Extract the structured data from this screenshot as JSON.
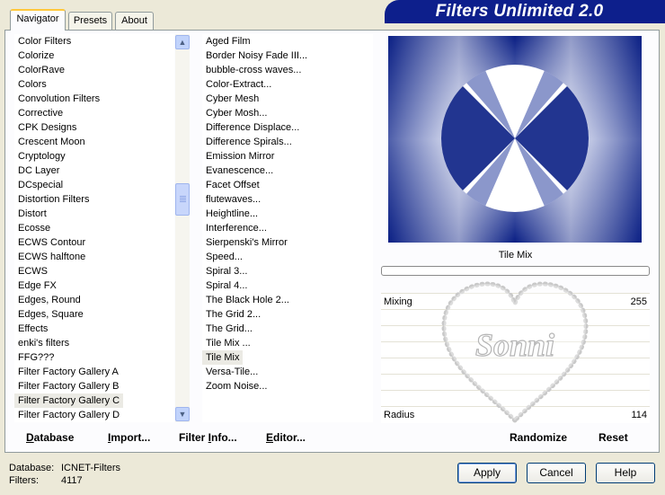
{
  "banner": {
    "title": "Filters Unlimited 2.0"
  },
  "tabs": {
    "navigator": "Navigator",
    "presets": "Presets",
    "about": "About"
  },
  "categories": {
    "items": [
      "Color Filters",
      "Colorize",
      "ColorRave",
      "Colors",
      "Convolution Filters",
      "Corrective",
      "CPK Designs",
      "Crescent Moon",
      "Cryptology",
      "DC Layer",
      "DCspecial",
      "Distortion Filters",
      "Distort",
      "Ecosse",
      "ECWS Contour",
      "ECWS halftone",
      "ECWS",
      "Edge FX",
      "Edges, Round",
      "Edges, Square",
      "Effects",
      "enki's filters",
      "FFG???",
      "Filter Factory Gallery A",
      "Filter Factory Gallery B",
      "Filter Factory Gallery C",
      "Filter Factory Gallery D"
    ],
    "selected": "Filter Factory Gallery C"
  },
  "filters": {
    "items": [
      "Aged Film",
      "Border Noisy Fade III...",
      "bubble-cross waves...",
      "Color-Extract...",
      "Cyber Mesh",
      "Cyber Mosh...",
      "Difference Displace...",
      "Difference Spirals...",
      "Emission Mirror",
      "Evanescence...",
      "Facet Offset",
      "flutewaves...",
      "Heightline...",
      "Interference...",
      "Sierpenski's Mirror",
      "Speed...",
      "Spiral 3...",
      "Spiral 4...",
      "The Black Hole 2...",
      "The Grid 2...",
      "The Grid...",
      "Tile Mix ...",
      "Tile Mix",
      "Versa-Tile...",
      "Zoom Noise..."
    ],
    "selected": "Tile Mix"
  },
  "preview": {
    "filter_name": "Tile Mix",
    "progress": 0
  },
  "params": {
    "mixing_label": "Mixing",
    "mixing_value": "255",
    "radius_label": "Radius",
    "radius_value": "114"
  },
  "watermark": {
    "text": "Sonni"
  },
  "bottom": {
    "database_label": "Database",
    "import_label": "Import...",
    "filter_info_label": "Filter Info...",
    "editor_label": "Editor...",
    "randomize_label": "Randomize",
    "reset_label": "Reset"
  },
  "status": {
    "database_key": "Database:",
    "database_value": "ICNET-Filters",
    "filters_key": "Filters:",
    "filters_value": "4117"
  },
  "buttons": {
    "apply": "Apply",
    "cancel": "Cancel",
    "help": "Help"
  },
  "colors": {
    "banner": "#0d1f8c",
    "preview_dark": "#0a1f84",
    "window_bg": "#ece9d8"
  }
}
